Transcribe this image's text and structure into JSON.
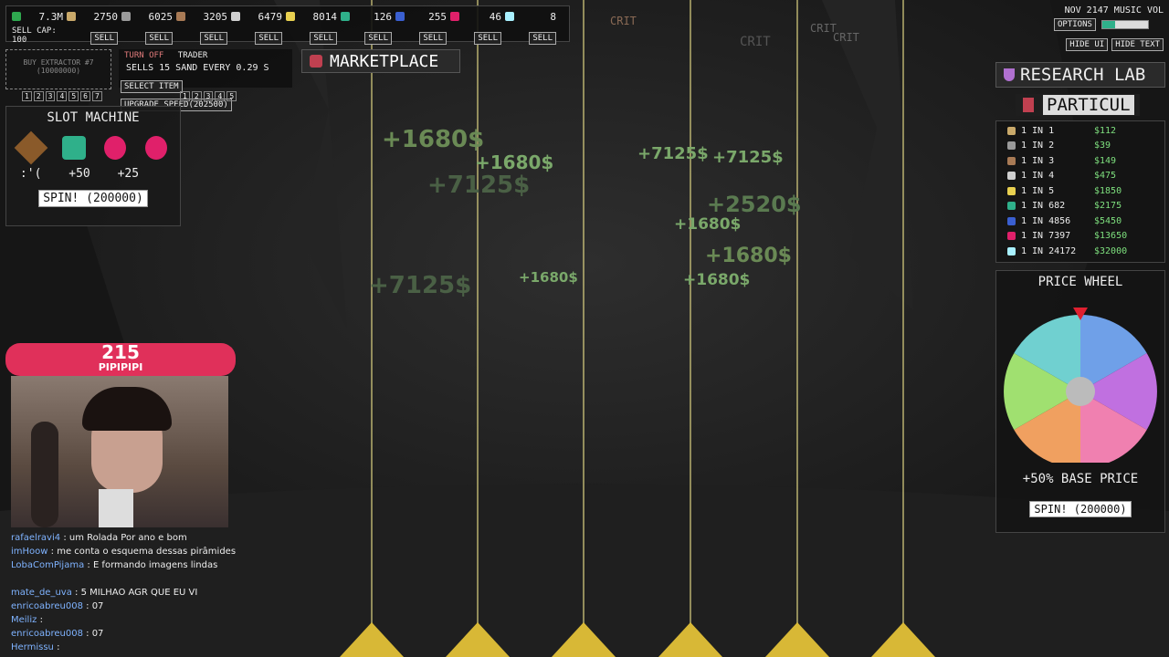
{
  "resources": [
    {
      "amount": "7.3M",
      "color": "#2fa84f",
      "sub": "SELL CAP: 100",
      "sub_is_label": true
    },
    {
      "amount": "2750",
      "color": "#c9a96a",
      "sell": "SELL"
    },
    {
      "amount": "6025",
      "color": "#9a9a9a",
      "sell": "SELL"
    },
    {
      "amount": "3205",
      "color": "#a87a55",
      "sell": "SELL"
    },
    {
      "amount": "6479",
      "color": "#cfcfcf",
      "sell": "SELL"
    },
    {
      "amount": "8014",
      "color": "#e8d050",
      "sell": "SELL"
    },
    {
      "amount": "126",
      "color": "#2fb08a",
      "sell": "SELL"
    },
    {
      "amount": "255",
      "color": "#3a5fd0",
      "sell": "SELL"
    },
    {
      "amount": "46",
      "color": "#e0206a",
      "sell": "SELL"
    },
    {
      "amount": "8",
      "color": "#a8f0ff",
      "sell": "SELL"
    }
  ],
  "extractor": {
    "label": "BUY EXTRACTOR #7",
    "cost": "(10000000)",
    "tabs": [
      "1",
      "2",
      "3",
      "4",
      "5",
      "6",
      "7"
    ]
  },
  "trader": {
    "turn_off": "TURN OFF",
    "title": "TRADER",
    "desc": "SELLS 15 SAND EVERY 0.29 S",
    "select": "SELECT ITEM",
    "upgrade": "UPGRADE SPEED(202500)",
    "tabs": [
      "1",
      "2",
      "3",
      "4",
      "5"
    ]
  },
  "marketplace": {
    "label": "MARKETPLACE"
  },
  "slot_machine": {
    "title": "SLOT MACHINE",
    "results": [
      ":'(",
      "+50",
      "+25"
    ],
    "spin": "SPIN! (200000)"
  },
  "top_right": {
    "date": "NOV 2147",
    "music": "MUSIC",
    "vol": "VOL",
    "options": "OPTIONS",
    "hide_ui": "HIDE UI",
    "hide_text": "HIDE TEXT"
  },
  "research_lab": {
    "title": "RESEARCH LAB",
    "sub": "PARTICUL",
    "rows": [
      {
        "odds": "1 IN 1",
        "price": "$112",
        "color": "#c9a96a"
      },
      {
        "odds": "1 IN 2",
        "price": "$39",
        "color": "#9a9a9a"
      },
      {
        "odds": "1 IN 3",
        "price": "$149",
        "color": "#a87a55"
      },
      {
        "odds": "1 IN 4",
        "price": "$475",
        "color": "#cfcfcf"
      },
      {
        "odds": "1 IN 5",
        "price": "$1850",
        "color": "#e8d050"
      },
      {
        "odds": "1 IN 682",
        "price": "$2175",
        "color": "#2fb08a"
      },
      {
        "odds": "1 IN 4856",
        "price": "$5450",
        "color": "#3a5fd0"
      },
      {
        "odds": "1 IN 7397",
        "price": "$13650",
        "color": "#e0206a"
      },
      {
        "odds": "1 IN 24172",
        "price": "$32000",
        "color": "#a8f0ff"
      }
    ]
  },
  "price_wheel": {
    "title": "PRICE WHEEL",
    "result": "+50% BASE PRICE",
    "spin": "SPIN! (200000)"
  },
  "floaters": [
    "+1680$",
    "+1680$",
    "+7125$",
    "+7125$",
    "+7125$",
    "+2520$",
    "+1680$",
    "+7125$",
    "+1680$",
    "+1680$",
    "+1680$"
  ],
  "crits": [
    "CRIT",
    "CRIT",
    "CRIT",
    "CRIT"
  ],
  "stream": {
    "badge_num": "215",
    "badge_name": "PIPIPIPI"
  },
  "chat": [
    {
      "user": "rafaelravi4",
      "msg": ": um Rolada Por ano e bom"
    },
    {
      "user": "imHoow",
      "msg": ": me conta o esquema dessas pirâmides"
    },
    {
      "user": "LobaComPijama",
      "msg": ": E formando imagens lindas"
    },
    {
      "user": "",
      "msg": ""
    },
    {
      "user": "mate_de_uva",
      "msg": ": 5 MILHAO AGR QUE EU VI"
    },
    {
      "user": "enricoabreu008",
      "msg": ": 07"
    },
    {
      "user": "Meiliz",
      "msg": ":"
    },
    {
      "user": "enricoabreu008",
      "msg": ": 07"
    },
    {
      "user": "Hermissu",
      "msg": ":"
    }
  ]
}
